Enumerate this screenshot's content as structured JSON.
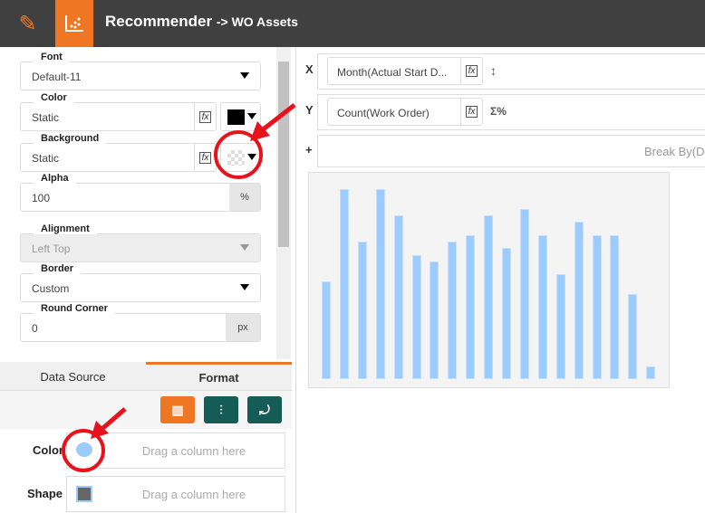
{
  "header": {
    "title": "Recommender",
    "subtitle": "-> WO Assets"
  },
  "format": {
    "font": {
      "label": "Font",
      "value": "Default-11"
    },
    "color": {
      "label": "Color",
      "value": "Static",
      "swatch": "#000000"
    },
    "background": {
      "label": "Background",
      "value": "Static"
    },
    "alpha": {
      "label": "Alpha",
      "value": "100",
      "unit": "%"
    },
    "alignment": {
      "label": "Alignment",
      "value": "Left Top"
    },
    "border": {
      "label": "Border",
      "value": "Custom"
    },
    "round_corner": {
      "label": "Round Corner",
      "value": "0",
      "unit": "px"
    }
  },
  "tabs": [
    "Data Source",
    "Format"
  ],
  "fx_label": "fx",
  "bindings": {
    "color": {
      "label": "Color",
      "placeholder": "Drag a column here"
    },
    "shape": {
      "label": "Shape",
      "placeholder": "Drag a column here"
    }
  },
  "axes": {
    "x": {
      "label": "X",
      "field": "Month(Actual Start D..."
    },
    "y": {
      "label": "Y",
      "field": "Count(Work Order)",
      "agg_icon": "Σ%"
    },
    "break": {
      "label": "+",
      "placeholder": "Break By(Di"
    }
  },
  "colors": {
    "accent": "#ef7622",
    "teal": "#145c55",
    "bar": "#9ccbfd",
    "annotation": "#e8121b"
  },
  "chart_data": {
    "type": "bar",
    "values": [
      15,
      29,
      21,
      29,
      25,
      19,
      18,
      21,
      22,
      25,
      20,
      26,
      22,
      16,
      24,
      22,
      22,
      13,
      2
    ],
    "ylim": [
      0,
      30
    ],
    "grid": false
  }
}
